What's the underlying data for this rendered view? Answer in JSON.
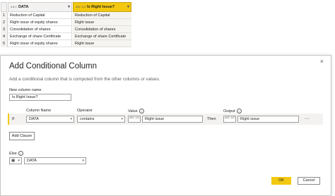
{
  "table": {
    "col1": {
      "type": "A B C",
      "name": "DATA"
    },
    "col2": {
      "type": "ABC 123",
      "name": "Is Right Issue?"
    },
    "rows": [
      {
        "n": "1",
        "data": "Reduction of Capital",
        "result": "Reduction of Capital"
      },
      {
        "n": "2",
        "data": "Right issue of equity shares",
        "result": "Right issue"
      },
      {
        "n": "3",
        "data": "Consolidation of shares",
        "result": "Consolidation of shares"
      },
      {
        "n": "4",
        "data": "Exchange of share Certificate",
        "result": "Exchange of share Certificate"
      },
      {
        "n": "5",
        "data": "Right issue of equity shares",
        "result": "Right issue"
      }
    ]
  },
  "dialog": {
    "title": "Add Conditional Column",
    "description": "Add a conditional column that is computed from the other columns or values.",
    "new_column_label": "New column name",
    "new_column_value": "Is Right Issue?",
    "headers": {
      "column_name": "Column Name",
      "operator": "Operator",
      "value": "Value",
      "output": "Output"
    },
    "clause": {
      "if": "If",
      "column": "DATA",
      "operator": "contains",
      "value_type": "ABC 123",
      "value": "Right issue",
      "then": "Then",
      "output_type": "ABC 123",
      "output": "Right issue",
      "more": "···"
    },
    "add_clause": "Add Clause",
    "else_label": "Else",
    "else_value": "DATA",
    "ok": "OK",
    "cancel": "Cancel",
    "close_icon": "×",
    "accent": "#f2c811"
  }
}
